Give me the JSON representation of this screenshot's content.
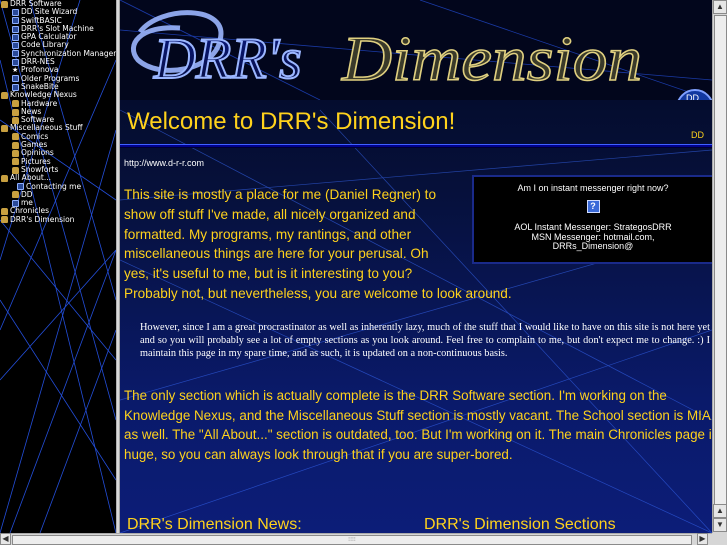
{
  "nav": {
    "items": [
      {
        "label": "DRR Software",
        "level": 0,
        "icon": "folder-icon"
      },
      {
        "label": "DD Site Wizard",
        "level": 1,
        "icon": "program-icon"
      },
      {
        "label": "SwiftBASIC",
        "level": 1,
        "icon": "program-icon"
      },
      {
        "label": "DRR's Slot Machine",
        "level": 1,
        "icon": "program-icon"
      },
      {
        "label": "GPA Calculator",
        "level": 1,
        "icon": "program-icon"
      },
      {
        "label": "Code Library",
        "level": 1,
        "icon": "program-icon"
      },
      {
        "label": "Synchronization Manager",
        "level": 1,
        "icon": "program-icon"
      },
      {
        "label": "DRR-NES",
        "level": 1,
        "icon": "program-icon"
      },
      {
        "label": "Profonova",
        "level": 1,
        "icon": "star-icon"
      },
      {
        "label": "Older Programs",
        "level": 1,
        "icon": "program-icon"
      },
      {
        "label": "SnakeBite",
        "level": 1,
        "icon": "program-icon"
      },
      {
        "label": "Knowledge Nexus",
        "level": 0,
        "icon": "folder-icon"
      },
      {
        "label": "Hardware",
        "level": 1,
        "icon": "folder-icon"
      },
      {
        "label": "News",
        "level": 1,
        "icon": "folder-icon"
      },
      {
        "label": "Software",
        "level": 1,
        "icon": "folder-icon"
      },
      {
        "label": "Miscellaneous Stuff",
        "level": 0,
        "icon": "folder-icon"
      },
      {
        "label": "Comics",
        "level": 1,
        "icon": "folder-icon"
      },
      {
        "label": "Games",
        "level": 1,
        "icon": "folder-icon"
      },
      {
        "label": "Opinions",
        "level": 1,
        "icon": "folder-icon"
      },
      {
        "label": "Pictures",
        "level": 1,
        "icon": "folder-icon"
      },
      {
        "label": "Snowforts",
        "level": 1,
        "icon": "folder-icon"
      },
      {
        "label": "All About...",
        "level": 0,
        "icon": "folder-icon"
      },
      {
        "label": "Contacting me",
        "level": 2,
        "icon": "page-icon"
      },
      {
        "label": "DD",
        "level": 1,
        "icon": "folder-icon"
      },
      {
        "label": "me",
        "level": 1,
        "icon": "page-icon"
      },
      {
        "label": "Chronicles",
        "level": 0,
        "icon": "folder-icon"
      },
      {
        "label": "DRR's Dimension",
        "level": 0,
        "icon": "folder-icon"
      }
    ]
  },
  "banner": {
    "logo_left": "DRR's",
    "logo_right": "Dimension",
    "badge": "DD"
  },
  "main": {
    "welcome": "Welcome to DRR's Dimension!",
    "dd_link": "DD",
    "url": "http://www.d-r-r.com",
    "intro_lines": [
      "This site is mostly a place for me (Daniel Regner) to",
      "show off stuff I've made, all nicely organized and",
      "formatted. My programs, my rantings, and other",
      "miscellaneous things are here for your perusal. Oh",
      "yes, it's useful to me, but is it interesting to you?",
      "Probably not, but nevertheless, you are welcome to look around."
    ],
    "im_box": {
      "question": "Am I on instant messenger right now?",
      "status_icon": "?",
      "aol": "AOL Instant Messenger: StrategosDRR",
      "msn": "MSN Messenger: hotmail.com,",
      "msn2": "DRRs_Dimension@"
    },
    "note": "However, since I am a great procrastinator as well as inherently lazy, much of the stuff that I would like to have on this site is not here yet and so you will probably see a lot of empty sections as you look around. Feel free to complain to me, but don't expect me to change. :) I maintain this page in my spare time, and as such, it is updated on a non-continuous basis.",
    "note2": "The only section which is actually complete is the DRR Software section. I'm working on the Knowledge Nexus, and the Miscellaneous Stuff section is mostly vacant. The School section is MIA as well. The \"All About...\" section is outdated, too. But I'm working on it. The main Chronicles page is huge, so you can always look through that if you are super-bored.",
    "news_title": "DRR's Dimension News:",
    "sections_title": "DRR's Dimension Sections"
  },
  "colors": {
    "text_accent": "#ffd21c",
    "background_dark": "#020820",
    "background_light": "#0c1d78"
  }
}
